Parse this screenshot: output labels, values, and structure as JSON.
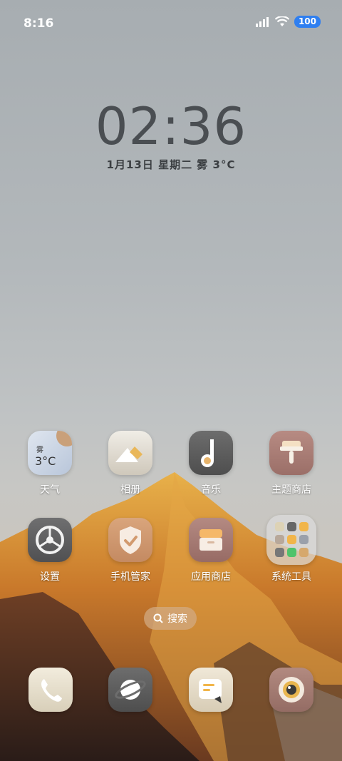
{
  "status_bar": {
    "time": "8:16",
    "battery": "100"
  },
  "lockclock": {
    "time": "02:36",
    "date": "1月13日  星期二  雾  3°C"
  },
  "weather_icon": {
    "condition": "雾",
    "temp": "3°C"
  },
  "apps_row1": [
    {
      "label": "天气"
    },
    {
      "label": "相册"
    },
    {
      "label": "音乐"
    },
    {
      "label": "主题商店"
    }
  ],
  "apps_row2": [
    {
      "label": "设置"
    },
    {
      "label": "手机管家"
    },
    {
      "label": "应用商店"
    },
    {
      "label": "系统工具"
    }
  ],
  "search": {
    "label": "搜索"
  },
  "colors": {
    "accent": "#2f7ff0"
  }
}
